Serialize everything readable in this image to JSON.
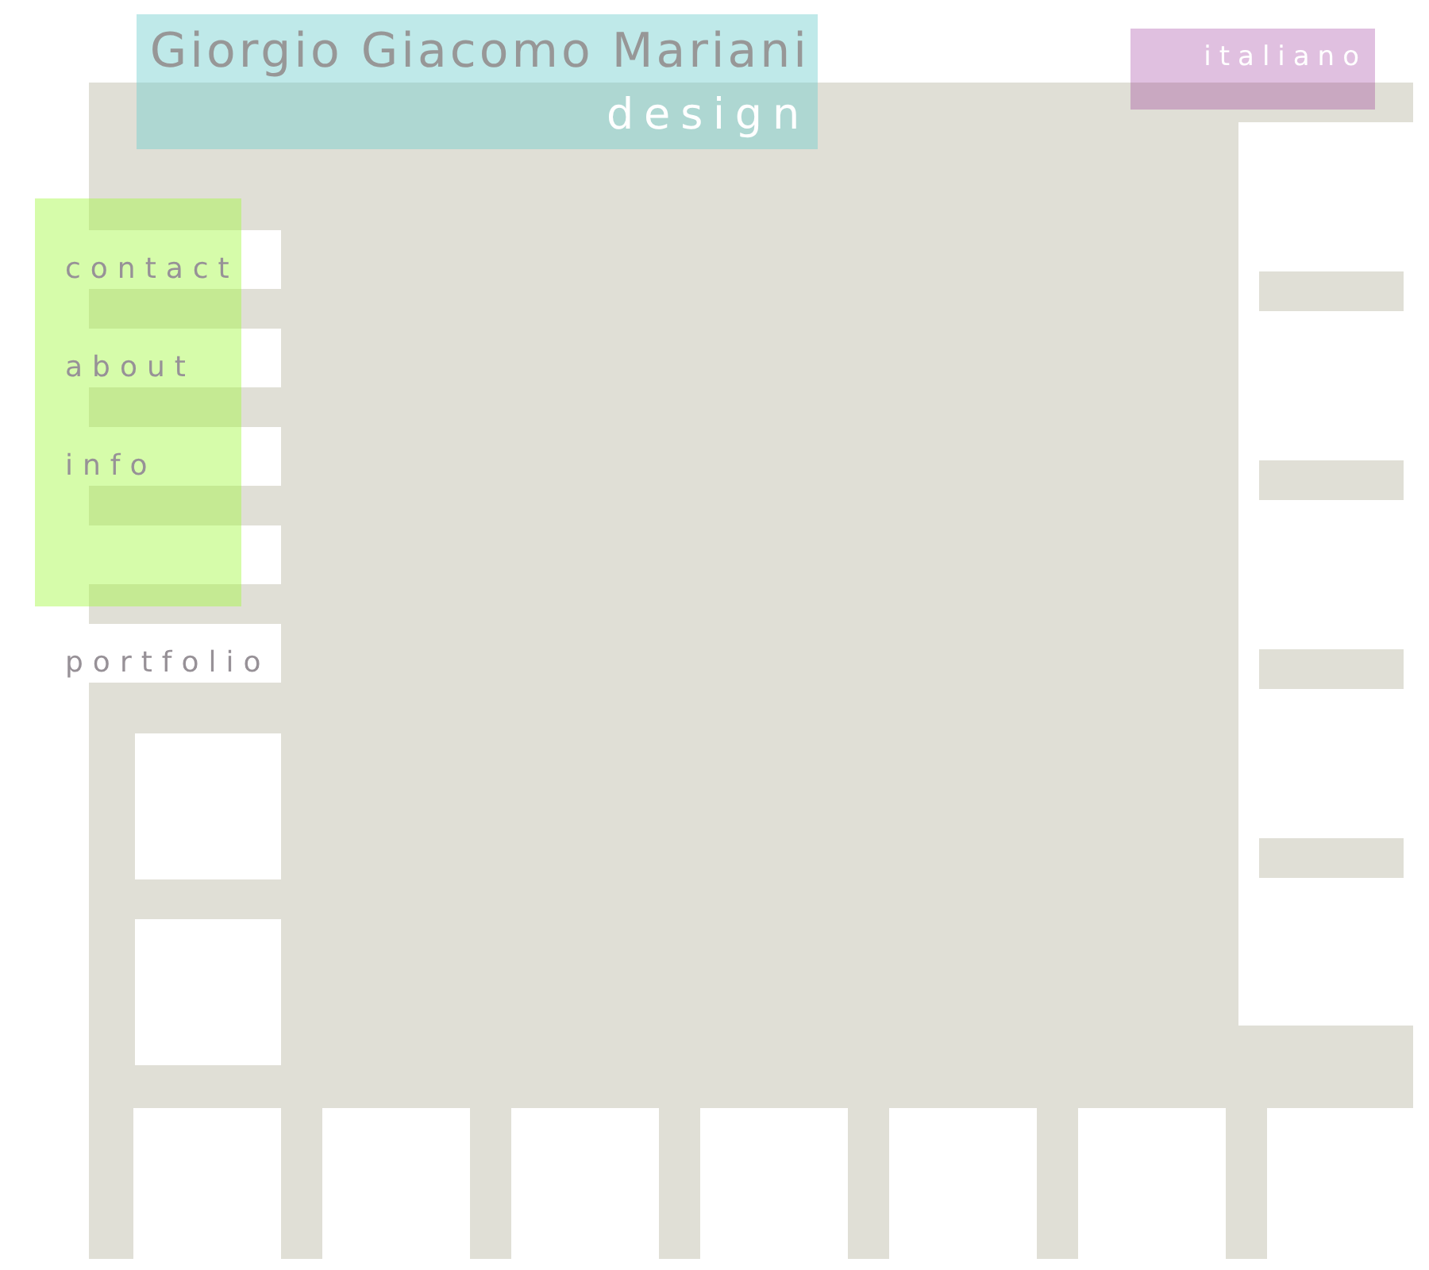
{
  "header": {
    "title": "Giorgio Giacomo Mariani",
    "subtitle": "design"
  },
  "language_link": {
    "label": "italiano"
  },
  "menu": {
    "items": [
      {
        "label": "contact"
      },
      {
        "label": "about"
      },
      {
        "label": "info"
      }
    ]
  },
  "portfolio_link": {
    "label": "portfolio"
  }
}
